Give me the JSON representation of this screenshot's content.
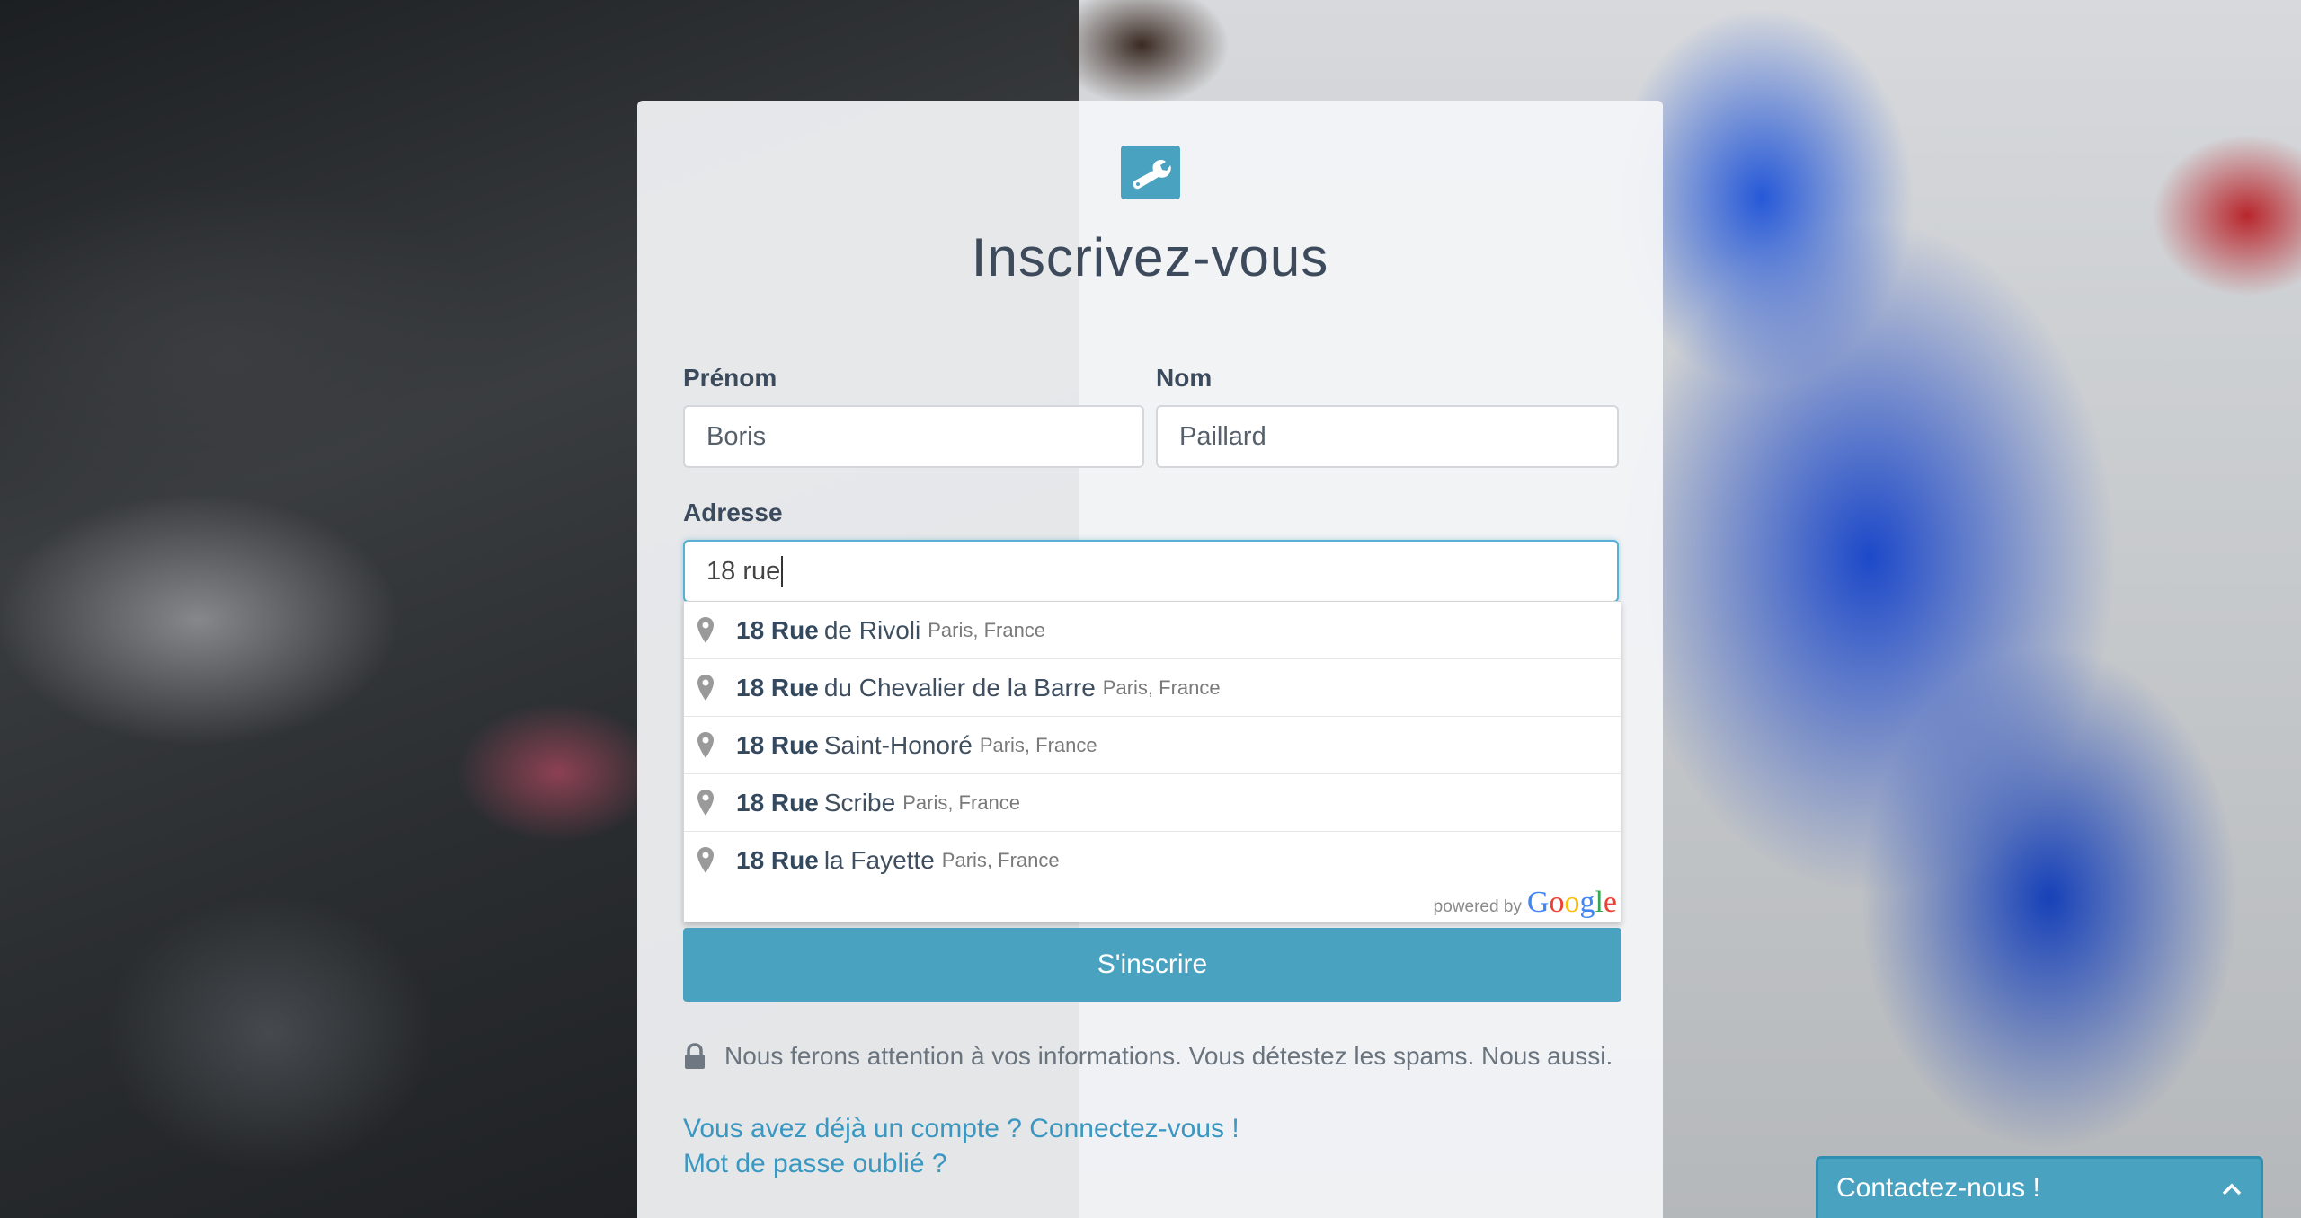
{
  "form": {
    "title": "Inscrivez-vous",
    "firstname_label": "Prénom",
    "firstname_value": "Boris",
    "lastname_label": "Nom",
    "lastname_value": "Paillard",
    "address_label": "Adresse",
    "address_value": "18 rue",
    "submit_label": "S'inscrire"
  },
  "autocomplete": {
    "suggestions": [
      {
        "match": "18 Rue",
        "rest": "de Rivoli",
        "secondary": "Paris, France"
      },
      {
        "match": "18 Rue",
        "rest": "du Chevalier de la Barre",
        "secondary": "Paris, France"
      },
      {
        "match": "18 Rue",
        "rest": "Saint-Honoré",
        "secondary": "Paris, France"
      },
      {
        "match": "18 Rue",
        "rest": "Scribe",
        "secondary": "Paris, France"
      },
      {
        "match": "18 Rue",
        "rest": "la Fayette",
        "secondary": "Paris, France"
      }
    ],
    "powered_by": "powered by",
    "google": "Google"
  },
  "privacy_text": "Nous ferons attention à vos informations. Vous détestez les spams. Nous aussi.",
  "links": {
    "login": "Vous avez déjà un compte ? Connectez-vous !",
    "forgot": "Mot de passe oublié ?"
  },
  "contact_widget": {
    "label": "Contactez-nous !"
  },
  "colors": {
    "accent": "#4aa2c1",
    "link": "#3a97c1",
    "title": "#3c4a5c"
  },
  "icons": {
    "logo": "wrench-icon",
    "pin": "map-pin-icon",
    "lock": "lock-icon",
    "chevron": "chevron-up-icon"
  }
}
